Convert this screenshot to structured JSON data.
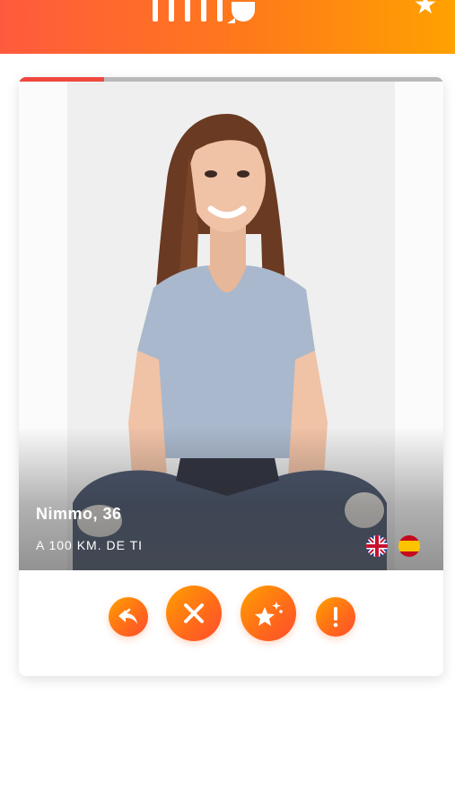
{
  "header": {
    "logo_icon": "app-logo",
    "favorite_icon": "star-icon"
  },
  "profile": {
    "name_age": "Nimmo, 36",
    "distance": "A 100 KM. DE TI",
    "photo_progress": 0.2,
    "languages": [
      {
        "icon": "uk-flag-icon",
        "code": "en"
      },
      {
        "icon": "spain-flag-icon",
        "code": "es"
      }
    ]
  },
  "actions": {
    "back_icon": "undo-arrow-icon",
    "nope_icon": "close-icon",
    "super_icon": "sparkle-star-icon",
    "report_icon": "exclamation-icon"
  },
  "colors": {
    "header_start": "#ff5a3d",
    "header_end": "#ffa100",
    "progress": "#f0483e",
    "button": "#ff7a1a"
  }
}
